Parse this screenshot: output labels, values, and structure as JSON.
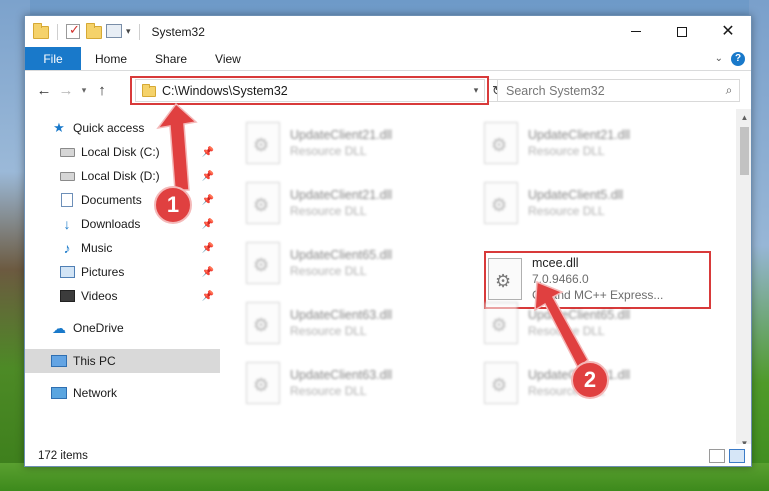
{
  "window": {
    "title": "System32"
  },
  "ribbon": {
    "file_tab": "File",
    "tabs": [
      "Home",
      "Share",
      "View"
    ],
    "help_label": "?"
  },
  "nav": {
    "address_path": "C:\\Windows\\System32",
    "search_placeholder": "Search System32"
  },
  "sidebar": {
    "quick_access": "Quick access",
    "items": [
      {
        "label": "Local Disk (C:)",
        "icon": "drive-icon"
      },
      {
        "label": "Local Disk (D:)",
        "icon": "drive-icon"
      },
      {
        "label": "Documents",
        "icon": "documents-icon"
      },
      {
        "label": "Downloads",
        "icon": "downloads-icon"
      },
      {
        "label": "Music",
        "icon": "music-icon"
      },
      {
        "label": "Pictures",
        "icon": "pictures-icon"
      },
      {
        "label": "Videos",
        "icon": "videos-icon"
      }
    ],
    "onedrive": "OneDrive",
    "this_pc": "This PC",
    "network": "Network"
  },
  "files": {
    "left_column": [
      {
        "name": "UpdateClient21.dll",
        "type": "Resource DLL"
      },
      {
        "name": "UpdateClient21.dll",
        "type": "Resource DLL"
      },
      {
        "name": "UpdateClient65.dll",
        "type": "Resource DLL"
      },
      {
        "name": "UpdateClient63.dll",
        "type": "Resource DLL"
      },
      {
        "name": "UpdateClient63.dll",
        "type": "Resource DLL"
      }
    ],
    "right_column": [
      {
        "name": "UpdateClient21.dll",
        "type": "Resource DLL"
      },
      {
        "name": "UpdateClient5.dll",
        "type": "Resource DLL"
      }
    ],
    "highlighted": {
      "name": "mcee.dll",
      "version": "7.0.9466.0",
      "description": "C# and MC++ Express..."
    },
    "right_column_below": [
      {
        "name": "UpdateClient65.dll",
        "type": "Resource DLL"
      },
      {
        "name": "UpdateClient21.dll",
        "type": "Resource DLL"
      }
    ]
  },
  "status": {
    "item_count": "172 items"
  },
  "annotations": {
    "step1": "1",
    "step2": "2",
    "accent": "#e04040"
  }
}
